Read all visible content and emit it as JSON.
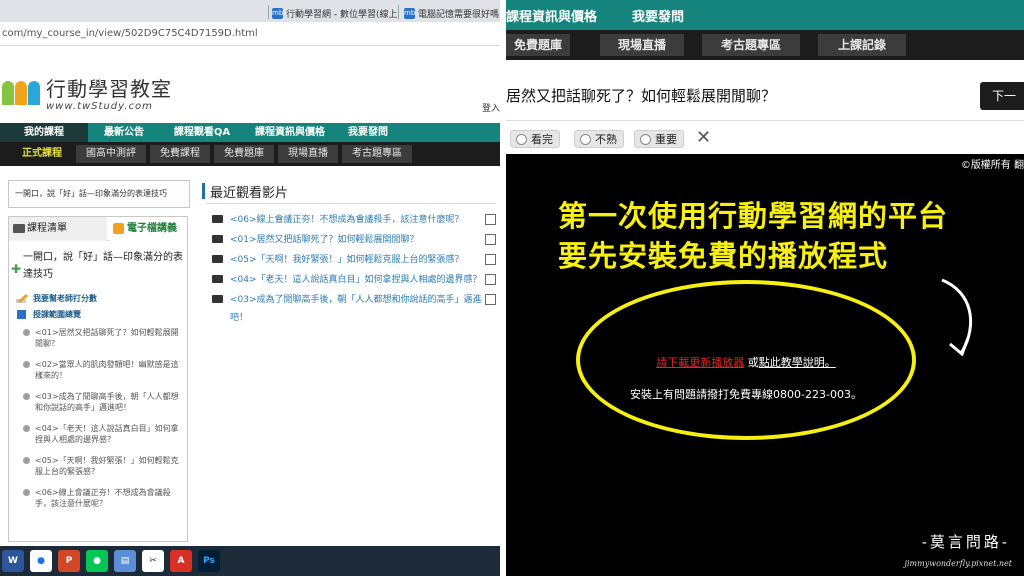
{
  "browser": {
    "tab1_title": "行動學習網 - 數位學習(線上",
    "tab2_title": "電腦記憶需要很好嗎",
    "tab_icon": "mb",
    "url": "com/my_course_in/view/502D9C75C4D7159D.html"
  },
  "site": {
    "logo_title": "行動學習教室",
    "logo_sub": "www.twStudy.com",
    "login_hint": "登入",
    "brand_colors": {
      "teal": "#15847d",
      "dark": "#1c1c1c",
      "highlight": "#e3df3c",
      "link": "#2c7cb5"
    },
    "main_nav": [
      "我的課程",
      "最新公告",
      "課程觀看QA",
      "課程資訊與價格",
      "我要發問"
    ],
    "sub_nav": [
      "正式課程",
      "國高中測評",
      "免費課程",
      "免費題庫",
      "現場直播",
      "考古題專區"
    ]
  },
  "left": {
    "current_lesson": "一開口，說「好」話—印象滿分的表達技巧",
    "course_tab": "課程清單",
    "ebook_tab": "電子檔講義",
    "course_title": "一開口，說「好」話—印象滿分的表達技巧",
    "rate_teacher": "我要幫老師打分數",
    "outline": "授課範圍總覽",
    "lessons": [
      "<01>居然又把話聊死了？如何輕鬆展開閒聊？",
      "<02>當眾人的肌肉發顫吧！幽默感是這樣來的！",
      "<03>成為了閒聊高手後，朝「人人都想和你說話的高手」邁進吧！",
      "<04>「老天！這人說話真白目」如何拿捏與人相處的邊界感？",
      "<05>「天啊！我好緊張！」如何輕鬆克服上台的緊張感？",
      "<06>線上會議正夯！不想成為會議殺手，該注意什麼呢？"
    ],
    "recent_title": "最近觀看影片",
    "recent": [
      "<06>線上會議正夯！不想成為會議殺手，該注意什麼呢？",
      "<01>居然又把話聊死了？如何輕鬆展開閒聊？",
      "<05>「天啊！我好緊張！」如何輕鬆克服上台的緊張感？",
      "<04>「老天！這人說話真白目」如何拿捏與人相處的邊界感？",
      "<03>成為了閒聊高手後，朝「人人都想和你說話的高手」邁進吧！"
    ],
    "taskbar": [
      "W",
      "●",
      "P",
      "●",
      "▤",
      "✂",
      "A",
      "Ps"
    ]
  },
  "right": {
    "top_nav": [
      "課程資訊與價格",
      "我要發問"
    ],
    "sub_nav": [
      "免費題庫",
      "現場直播",
      "考古題專區",
      "上課記錄"
    ],
    "video_title": "居然又把話聊死了？如何輕鬆展開閒聊？",
    "next_button": "下一",
    "rate_options": [
      "看完",
      "不熟",
      "重要"
    ],
    "close_symbol": "✕",
    "copyright": "©版權所有 翻",
    "annotation_line1": "第一次使用行動學習網的平台",
    "annotation_line2": "要先安裝免費的播放程式",
    "player_download": "請下載更新播放器",
    "player_or": " 或",
    "player_tutorial": "點此教學說明。",
    "player_help": "安裝上有問題請撥打免費專線0800-223-003。",
    "watermark": "-莫言問路-",
    "watermark_sub": "jimmywonderfly.pixnet.net",
    "annotation_color": "#f7ef11"
  }
}
